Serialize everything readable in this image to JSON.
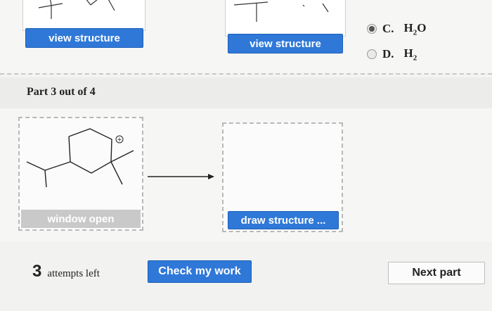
{
  "part1": {
    "view_structure_left": "view structure",
    "view_structure_right": "view structure"
  },
  "choices": [
    {
      "letter": "C.",
      "formula_main": "H",
      "formula_sub": "2",
      "formula_tail": "O",
      "selected": true
    },
    {
      "letter": "D.",
      "formula_main": "H",
      "formula_sub": "2",
      "formula_tail": "",
      "selected": false
    }
  ],
  "part_heading": "Part 3 out of 4",
  "reaction": {
    "reactant_button": "window open",
    "product_button": "draw structure ...",
    "charge_symbol": "+"
  },
  "footer": {
    "attempts_count": "3",
    "attempts_label": "attempts left",
    "check_button": "Check my work",
    "next_button": "Next part"
  },
  "colors": {
    "primary_button": "#2f78d8",
    "disabled_button": "#c9c9c9",
    "dashed_border": "#b8b8b8"
  }
}
